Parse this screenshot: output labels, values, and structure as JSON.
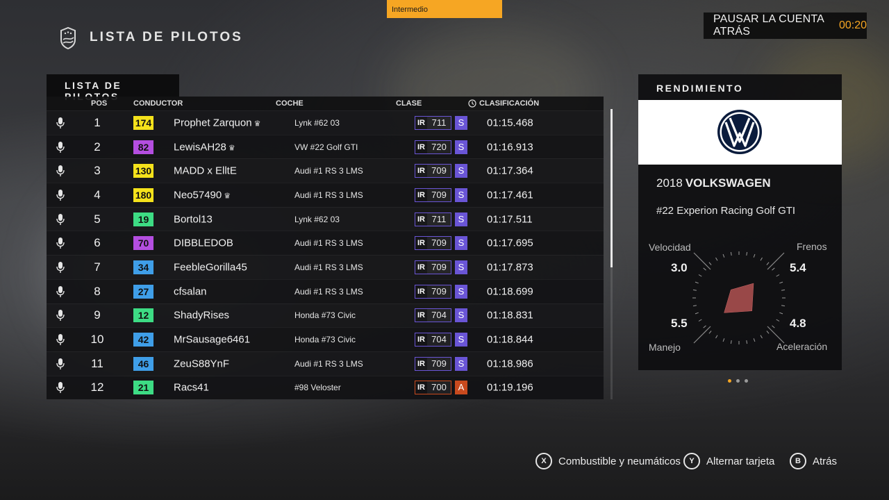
{
  "banner": {
    "label": "Intermedio"
  },
  "header": {
    "title": "LISTA DE PILOTOS"
  },
  "pause": {
    "label": "PAUSAR LA CUENTA ATRÁS",
    "time": "00:20"
  },
  "list": {
    "tab_title": "LISTA DE PILOTOS",
    "columns": {
      "pos": "POS",
      "driver": "CONDUCTOR",
      "car": "COCHE",
      "class": "CLASE",
      "qualifying": "CLASIFICACIÓN"
    },
    "rows": [
      {
        "pos": "1",
        "rating": "174",
        "rating_color": "#f5e21b",
        "driver": "Prophet Zarquon",
        "crown": true,
        "car": "Lynk #62 03",
        "class_prefix": "IR",
        "pi": "711",
        "class_letter": "S",
        "time": "01:15.468"
      },
      {
        "pos": "2",
        "rating": "82",
        "rating_color": "#b44ee0",
        "driver": "LewisAH28",
        "crown": true,
        "car": "VW #22 Golf GTI",
        "class_prefix": "IR",
        "pi": "720",
        "class_letter": "S",
        "time": "01:16.913"
      },
      {
        "pos": "3",
        "rating": "130",
        "rating_color": "#f5e21b",
        "driver": "MADD x ElltE",
        "crown": false,
        "car": "Audi #1 RS 3 LMS",
        "class_prefix": "IR",
        "pi": "709",
        "class_letter": "S",
        "time": "01:17.364"
      },
      {
        "pos": "4",
        "rating": "180",
        "rating_color": "#f5e21b",
        "driver": "Neo57490",
        "crown": true,
        "car": "Audi #1 RS 3 LMS",
        "class_prefix": "IR",
        "pi": "709",
        "class_letter": "S",
        "time": "01:17.461"
      },
      {
        "pos": "5",
        "rating": "19",
        "rating_color": "#3ddc84",
        "driver": "Bortol13",
        "crown": false,
        "car": "Lynk #62 03",
        "class_prefix": "IR",
        "pi": "711",
        "class_letter": "S",
        "time": "01:17.511"
      },
      {
        "pos": "6",
        "rating": "70",
        "rating_color": "#b44ee0",
        "driver": "DIBBLEDOB",
        "crown": false,
        "car": "Audi #1 RS 3 LMS",
        "class_prefix": "IR",
        "pi": "709",
        "class_letter": "S",
        "time": "01:17.695"
      },
      {
        "pos": "7",
        "rating": "34",
        "rating_color": "#3f9ee8",
        "driver": "FeebleGorilla45",
        "crown": false,
        "car": "Audi #1 RS 3 LMS",
        "class_prefix": "IR",
        "pi": "709",
        "class_letter": "S",
        "time": "01:17.873"
      },
      {
        "pos": "8",
        "rating": "27",
        "rating_color": "#3f9ee8",
        "driver": "cfsalan",
        "crown": false,
        "car": "Audi #1 RS 3 LMS",
        "class_prefix": "IR",
        "pi": "709",
        "class_letter": "S",
        "time": "01:18.699"
      },
      {
        "pos": "9",
        "rating": "12",
        "rating_color": "#3ddc84",
        "driver": "ShadyRises",
        "crown": false,
        "car": "Honda #73 Civic",
        "class_prefix": "IR",
        "pi": "704",
        "class_letter": "S",
        "time": "01:18.831"
      },
      {
        "pos": "10",
        "rating": "42",
        "rating_color": "#3f9ee8",
        "driver": "MrSausage6461",
        "crown": false,
        "car": "Honda #73 Civic",
        "class_prefix": "IR",
        "pi": "704",
        "class_letter": "S",
        "time": "01:18.844"
      },
      {
        "pos": "11",
        "rating": "46",
        "rating_color": "#3f9ee8",
        "driver": "ZeuS88YnF",
        "crown": false,
        "car": "Audi #1 RS 3 LMS",
        "class_prefix": "IR",
        "pi": "709",
        "class_letter": "S",
        "time": "01:18.986"
      },
      {
        "pos": "12",
        "rating": "21",
        "rating_color": "#3ddc84",
        "driver": "Racs41",
        "crown": false,
        "car": "#98 Veloster",
        "class_prefix": "IR",
        "pi": "700",
        "class_letter": "A",
        "time": "01:19.196"
      }
    ],
    "class_colors": {
      "S": "#6a55d6",
      "A": "#c94a1e"
    }
  },
  "performance": {
    "title": "RENDIMIENTO",
    "year": "2018",
    "make": "VOLKSWAGEN",
    "model": "#22 Experion Racing Golf GTI",
    "stats": {
      "speed_label": "Velocidad",
      "speed": "3.0",
      "braking_label": "Frenos",
      "braking": "5.4",
      "handling_label": "Manejo",
      "handling": "5.5",
      "accel_label": "Aceleración",
      "accel": "4.8"
    },
    "page_indicator": {
      "count": 3,
      "active": 0
    }
  },
  "footer": {
    "x_key": "X",
    "x_label": "Combustible y neumáticos",
    "y_key": "Y",
    "y_label": "Alternar tarjeta",
    "b_key": "B",
    "b_label": "Atrás"
  }
}
